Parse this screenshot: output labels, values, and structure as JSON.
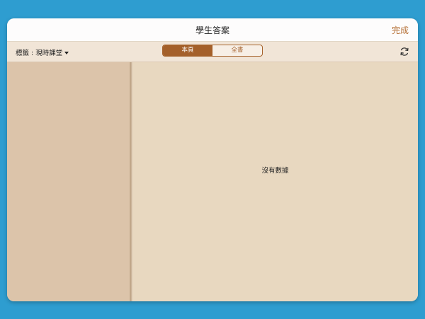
{
  "header": {
    "title": "學生答案",
    "done_label": "完成"
  },
  "toolbar": {
    "tag_filter_label": "標籤 : 現時課堂",
    "segments": [
      {
        "label": "本頁",
        "active": true
      },
      {
        "label": "全書",
        "active": false
      }
    ],
    "refresh_icon": "refresh-icon"
  },
  "main": {
    "empty_text": "沒有數據"
  },
  "colors": {
    "background": "#2e9dd0",
    "accent": "#a4602a",
    "panel": "#e8d8c0",
    "sidebar": "#dcc4aa"
  }
}
